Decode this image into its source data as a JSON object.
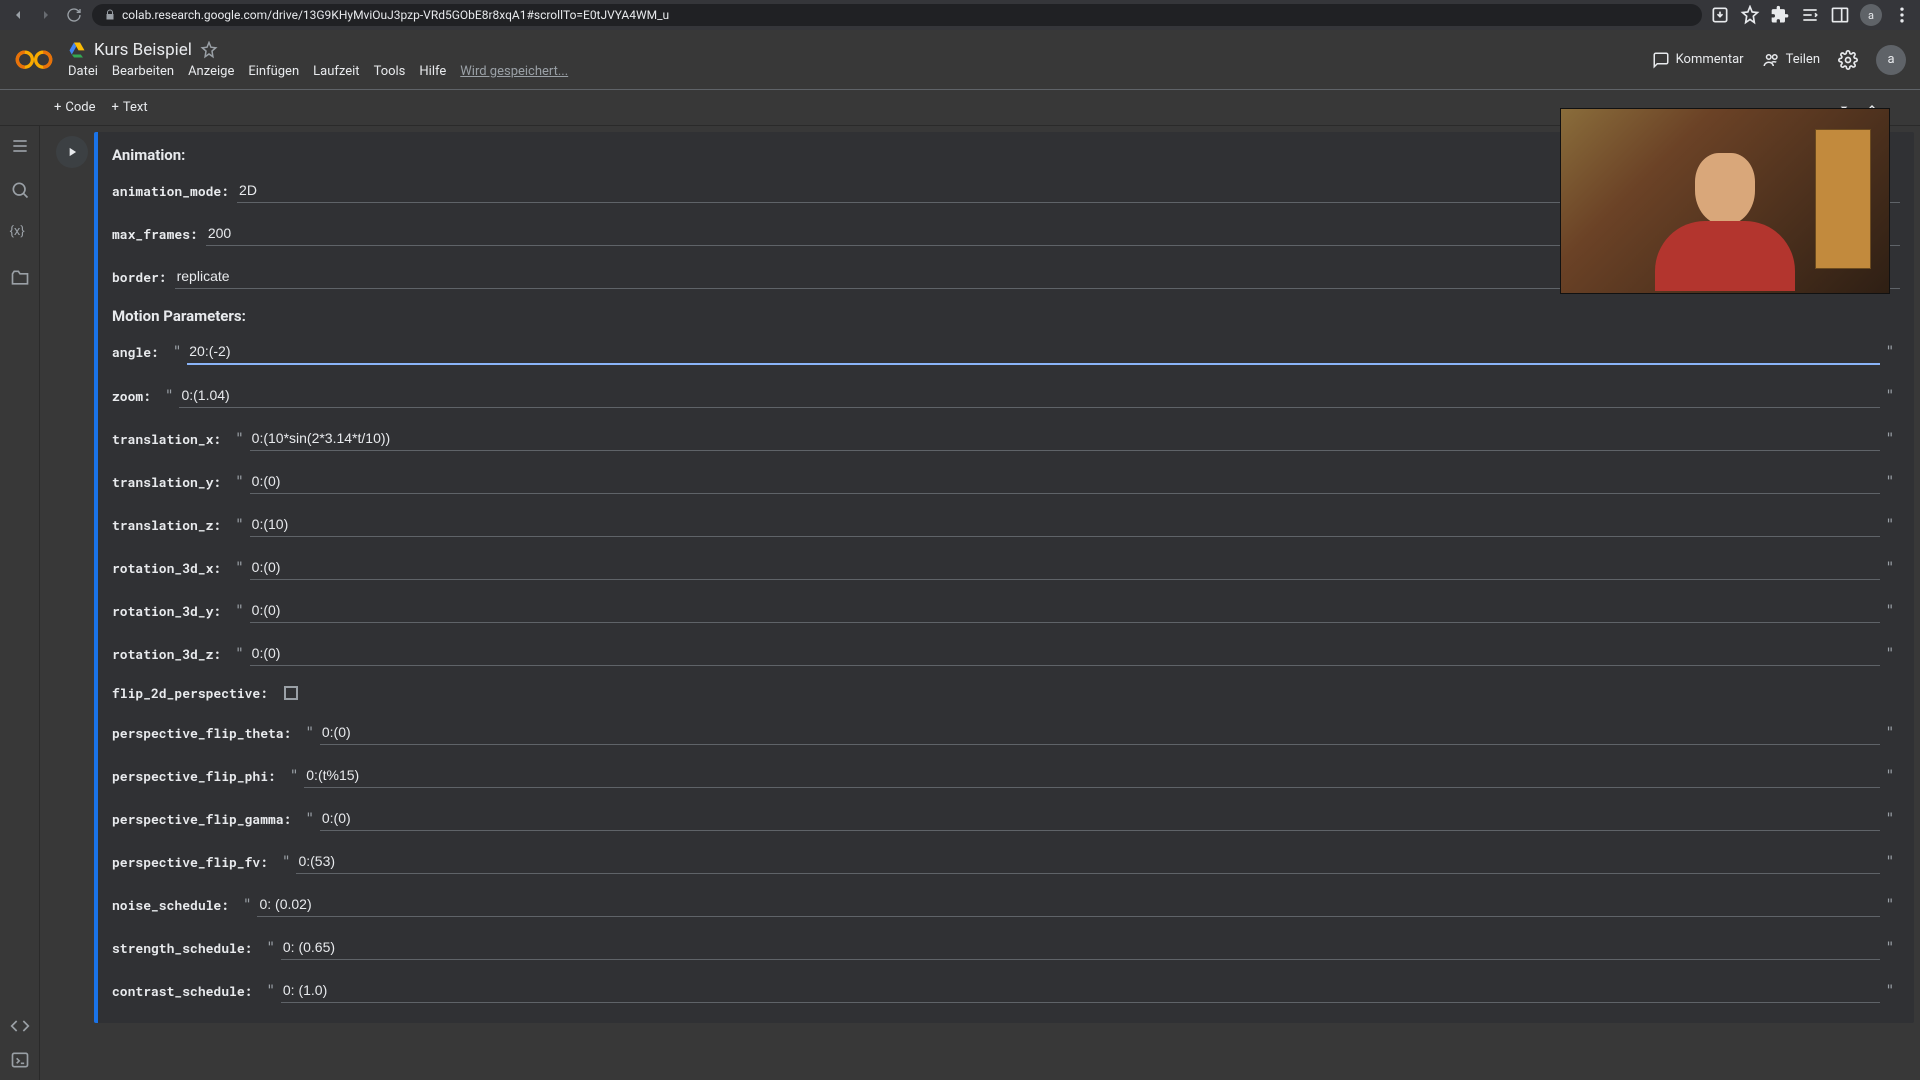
{
  "browser": {
    "url": "colab.research.google.com/drive/13G9KHyMviOuJ3pzp-VRd5GObE8r8xqA1#scrollTo=E0tJVYA4WM_u",
    "avatar": "a"
  },
  "header": {
    "title": "Kurs Beispiel",
    "menus": [
      "Datei",
      "Bearbeiten",
      "Anzeige",
      "Einfügen",
      "Laufzeit",
      "Tools",
      "Hilfe"
    ],
    "saving": "Wird gespeichert...",
    "comment": "Kommentar",
    "share": "Teilen",
    "avatar": "a"
  },
  "toolbar": {
    "code": "Code",
    "text": "Text"
  },
  "sections": {
    "animation": "Animation:",
    "motion": "Motion Parameters:"
  },
  "params": {
    "animation_mode": {
      "label": "animation_mode:",
      "value": "2D"
    },
    "max_frames": {
      "label": "max_frames:",
      "value": "200"
    },
    "border": {
      "label": "border:",
      "value": "replicate"
    },
    "angle": {
      "label": "angle:",
      "value": "20:(-2)"
    },
    "zoom": {
      "label": "zoom:",
      "value": "0:(1.04)"
    },
    "translation_x": {
      "label": "translation_x:",
      "value": "0:(10*sin(2*3.14*t/10))"
    },
    "translation_y": {
      "label": "translation_y:",
      "value": "0:(0)"
    },
    "translation_z": {
      "label": "translation_z:",
      "value": "0:(10)"
    },
    "rotation_3d_x": {
      "label": "rotation_3d_x:",
      "value": "0:(0)"
    },
    "rotation_3d_y": {
      "label": "rotation_3d_y:",
      "value": "0:(0)"
    },
    "rotation_3d_z": {
      "label": "rotation_3d_z:",
      "value": "0:(0)"
    },
    "flip_2d_perspective": {
      "label": "flip_2d_perspective:"
    },
    "perspective_flip_theta": {
      "label": "perspective_flip_theta:",
      "value": "0:(0)"
    },
    "perspective_flip_phi": {
      "label": "perspective_flip_phi:",
      "value": "0:(t%15)"
    },
    "perspective_flip_gamma": {
      "label": "perspective_flip_gamma:",
      "value": "0:(0)"
    },
    "perspective_flip_fv": {
      "label": "perspective_flip_fv:",
      "value": "0:(53)"
    },
    "noise_schedule": {
      "label": "noise_schedule:",
      "value": "0: (0.02)"
    },
    "strength_schedule": {
      "label": "strength_schedule:",
      "value": "0: (0.65)"
    },
    "contrast_schedule": {
      "label": "contrast_schedule:",
      "value": "0: (1.0)"
    }
  }
}
